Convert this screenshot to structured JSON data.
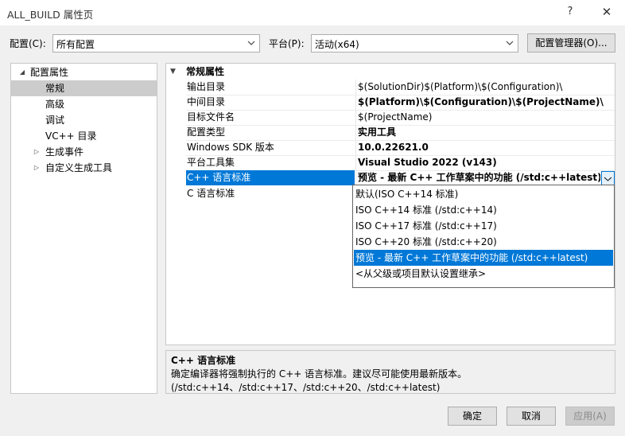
{
  "window": {
    "title": "ALL_BUILD 属性页",
    "help_glyph": "?",
    "close_glyph": "✕"
  },
  "toolbar": {
    "config_label": "配置(C):",
    "config_value": "所有配置",
    "platform_label": "平台(P):",
    "platform_value": "活动(x64)",
    "config_manager_label": "配置管理器(O)..."
  },
  "tree": {
    "root": "配置属性",
    "items": [
      "常规",
      "高级",
      "调试",
      "VC++ 目录",
      "生成事件",
      "自定义生成工具"
    ],
    "selected": "常规"
  },
  "grid": {
    "category": "常规属性",
    "rows": [
      {
        "name": "输出目录",
        "value": "$(SolutionDir)$(Platform)\\$(Configuration)\\"
      },
      {
        "name": "中间目录",
        "value": "$(Platform)\\$(Configuration)\\$(ProjectName)\\"
      },
      {
        "name": "目标文件名",
        "value": "$(ProjectName)"
      },
      {
        "name": "配置类型",
        "value": "实用工具"
      },
      {
        "name": "Windows SDK 版本",
        "value": "10.0.22621.0"
      },
      {
        "name": "平台工具集",
        "value": "Visual Studio 2022 (v143)"
      },
      {
        "name": "C++ 语言标准",
        "value": "预览 - 最新 C++ 工作草案中的功能 (/std:c++latest)"
      },
      {
        "name": "C 语言标准",
        "value": ""
      }
    ]
  },
  "dropdown": {
    "options": [
      "默认(ISO C++14 标准)",
      "ISO C++14 标准 (/std:c++14)",
      "ISO C++17 标准 (/std:c++17)",
      "ISO C++20 标准 (/std:c++20)",
      "预览 - 最新 C++ 工作草案中的功能 (/std:c++latest)",
      "<从父级或项目默认设置继承>"
    ],
    "selected_index": 4
  },
  "description": {
    "title": "C++ 语言标准",
    "text": "确定编译器将强制执行的 C++ 语言标准。建议尽可能使用最新版本。(/std:c++14、/std:c++17、/std:c++20、/std:c++latest)"
  },
  "buttons": {
    "ok": "确定",
    "cancel": "取消",
    "apply": "应用(A)"
  },
  "colors": {
    "selection": "#0078d7",
    "tree_selection": "#cccccc"
  }
}
